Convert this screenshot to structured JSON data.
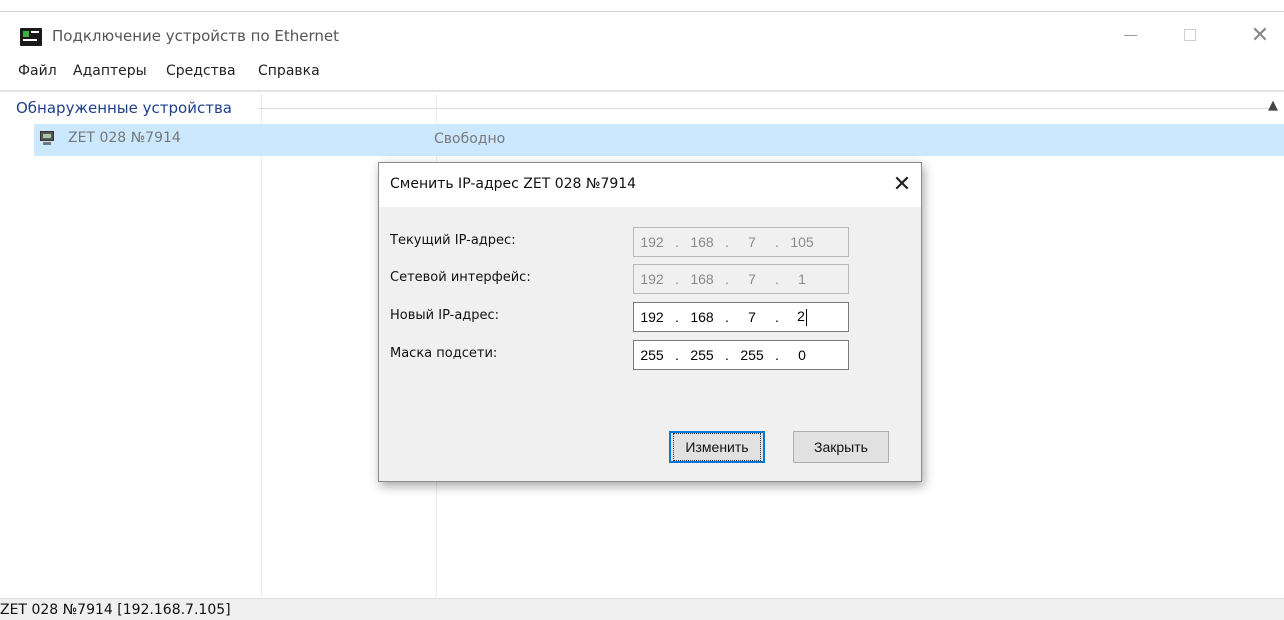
{
  "window": {
    "title": "Подключение устройств по Ethernet",
    "controls": {
      "minimize": "—",
      "maximize": "□",
      "close": "✕"
    }
  },
  "menu": [
    "Файл",
    "Адаптеры",
    "Средства",
    "Справка"
  ],
  "device_list": {
    "group_title": "Обнаруженные устройства",
    "collapse_icon": "chevron-up-icon",
    "devices": [
      {
        "name": "ZET 028 №7914",
        "status": "Свободно",
        "icon": "network-device-icon",
        "selected": true
      }
    ]
  },
  "status_bar": {
    "text": "ZET 028 №7914 [192.168.7.105]"
  },
  "dialog": {
    "title": "Сменить IP-адрес ZET 028 №7914",
    "close": "✕",
    "fields": [
      {
        "label": "Текущий IP-адрес:",
        "octets": [
          "192",
          "168",
          "7",
          "105"
        ],
        "enabled": false
      },
      {
        "label": "Сетевой интерфейс:",
        "octets": [
          "192",
          "168",
          "7",
          "1"
        ],
        "enabled": false
      },
      {
        "label": "Новый IP-адрес:",
        "octets": [
          "192",
          "168",
          "7",
          "2"
        ],
        "enabled": true,
        "focused": true
      },
      {
        "label": "Маска подсети:",
        "octets": [
          "255",
          "255",
          "255",
          "0"
        ],
        "enabled": true
      }
    ],
    "buttons": {
      "change": "Изменить",
      "close": "Закрыть"
    }
  },
  "colors": {
    "selection": "#cce8ff",
    "group_title": "#1f3f8a",
    "focus_border": "#0078d7"
  }
}
